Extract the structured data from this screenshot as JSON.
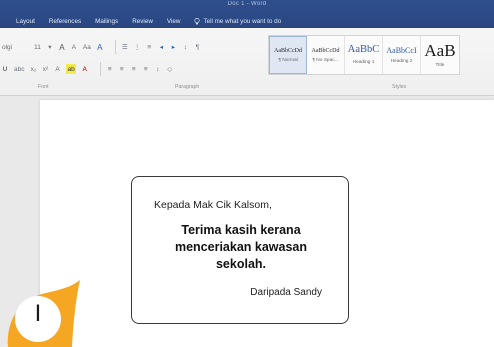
{
  "window": {
    "title": "Doc 1 - Word"
  },
  "tabs": [
    {
      "label": "Layout"
    },
    {
      "label": "References"
    },
    {
      "label": "Mailings"
    },
    {
      "label": "Review"
    },
    {
      "label": "View"
    }
  ],
  "tell_me": {
    "text": "Tell me what you want to do"
  },
  "ribbon": {
    "font_name": "olgi",
    "font_size": "11",
    "groups": {
      "font": "Font",
      "paragraph": "Paragraph",
      "styles": "Styles"
    },
    "styles": [
      {
        "sample": "AaBbCcDd",
        "name": "¶ Normal",
        "selected": true
      },
      {
        "sample": "AaBbCcDd",
        "name": "¶ No Spac..."
      },
      {
        "sample": "AaBbC",
        "name": "Heading 1"
      },
      {
        "sample": "AaBbCcI",
        "name": "Heading 2"
      },
      {
        "sample": "AaB",
        "name": "Title"
      }
    ]
  },
  "card": {
    "greeting": "Kepada Mak Cik Kalsom,",
    "message_lines": [
      "Terima kasih kerana",
      "menceriakan kawasan",
      "sekolah."
    ],
    "signoff": "Daripada Sandy"
  },
  "badge": {
    "label": "I",
    "color": "#f5a623"
  },
  "colors": {
    "title_bar": "#2b4a86",
    "highlight": "#f3ea4c",
    "font_color": "#c0392b"
  }
}
